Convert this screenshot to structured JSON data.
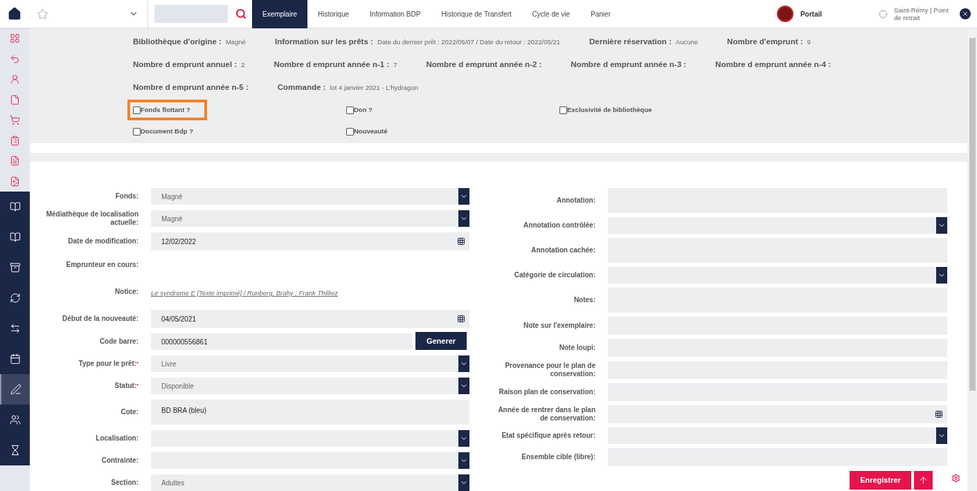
{
  "topbar": {
    "tabs": [
      {
        "label": "Exemplaire",
        "selected": true
      },
      {
        "label": "Historique",
        "selected": false
      },
      {
        "label": "Information BDP",
        "selected": false
      },
      {
        "label": "Historique de Transfert",
        "selected": false
      },
      {
        "label": "Cycle de vie",
        "selected": false
      },
      {
        "label": "Panier",
        "selected": false
      }
    ],
    "portal": "Portail",
    "location": "Saint-Rémy | Point de retrait"
  },
  "sidebar": {
    "items": [
      {
        "kind": "tool",
        "selected": false
      },
      {
        "kind": "tool",
        "selected": false
      },
      {
        "kind": "tool",
        "selected": false
      },
      {
        "kind": "tool",
        "selected": false
      },
      {
        "kind": "tool",
        "selected": false
      },
      {
        "kind": "tool",
        "selected": false
      },
      {
        "kind": "tool",
        "selected": false
      },
      {
        "kind": "tool",
        "selected": false
      },
      {
        "kind": "nav",
        "selected": false
      },
      {
        "kind": "nav",
        "selected": false
      },
      {
        "kind": "nav",
        "selected": false
      },
      {
        "kind": "nav",
        "selected": false
      },
      {
        "kind": "nav",
        "selected": false
      },
      {
        "kind": "nav",
        "selected": false
      },
      {
        "kind": "nav",
        "selected": true
      },
      {
        "kind": "nav",
        "selected": false
      },
      {
        "kind": "nav",
        "selected": false
      }
    ]
  },
  "info": {
    "lines": [
      {
        "fields": [
          {
            "label": "Bibliothèque d'origine :",
            "value": "Magné"
          },
          {
            "label": "Information sur les prêts :",
            "value": "Date du dernier prêt : 2022/05/07 / Date du retour : 2022/05/21"
          },
          {
            "label": "Dernière réservation :",
            "value": "Aucune"
          },
          {
            "label": "Nombre d'emprunt :",
            "value": "9"
          }
        ]
      },
      {
        "fields": [
          {
            "label": "Nombre d emprunt annuel :",
            "value": "2"
          },
          {
            "label": "Nombre d emprunt année n-1 :",
            "value": "7"
          },
          {
            "label": "Nombre d emprunt année n-2 :"
          },
          {
            "label": "Nombre d emprunt année n-3 :"
          },
          {
            "label": "Nombre d emprunt année n-4 :"
          }
        ]
      },
      {
        "fields": [
          {
            "label": "Nombre d emprunt année n-5 :"
          },
          {
            "label": "Commande :",
            "value": "lot 4 janvier 2021 - L'hydragon"
          }
        ]
      }
    ],
    "checkboxes": [
      {
        "label": "Fonds flottant ?",
        "checked": false,
        "highlighted": true
      },
      {
        "label": "Don ?",
        "checked": false,
        "highlighted": false
      },
      {
        "label": "Exclusivité de bibliothèque",
        "checked": false,
        "highlighted": false
      },
      {
        "label": "Document Bdp ?",
        "checked": false,
        "highlighted": false
      },
      {
        "label": "Nouveauté",
        "checked": false,
        "highlighted": false
      }
    ]
  },
  "form": {
    "left": [
      {
        "label": "Fonds:",
        "kind": "select",
        "value": "Magné"
      },
      {
        "label": "Médiathèque de localisation actuelle:",
        "kind": "select",
        "value": "Magné"
      },
      {
        "label": "Date de modification:",
        "kind": "date",
        "value": "12/02/2022"
      },
      {
        "label": "Emprunteur en cours:",
        "kind": "none"
      },
      {
        "label": "Notice:",
        "kind": "link",
        "value": "Le syndrome E [Texte imprimé] / Runberg, Brahy ; Frank Thilliez"
      },
      {
        "label": "Début de la nouveauté:",
        "kind": "date",
        "value": "04/05/2021"
      },
      {
        "label": "Code barre:",
        "kind": "barcode",
        "value": "000000556861",
        "button": "Generer"
      },
      {
        "label": "Type pour le prêt:",
        "required_mark": "*",
        "kind": "select",
        "value": "Livre"
      },
      {
        "label": "Statut:",
        "required_mark": "*",
        "kind": "select",
        "value": "Disponible"
      },
      {
        "label": "Cote:",
        "kind": "textarea",
        "value": "BD BRA (bleu)"
      },
      {
        "label": "Localisation:",
        "kind": "select"
      },
      {
        "label": "Contrainte:",
        "kind": "select"
      },
      {
        "label": "Section:",
        "kind": "select",
        "value": "Adultes"
      }
    ],
    "right": [
      {
        "label": "Annotation:",
        "kind": "textarea"
      },
      {
        "label": "Annotation contrôlée:",
        "kind": "select"
      },
      {
        "label": "Annotation cachée:",
        "kind": "textarea"
      },
      {
        "label": "Catégorie de circulation:",
        "kind": "select"
      },
      {
        "label": "Notes:",
        "kind": "textarea"
      },
      {
        "label": "Note sur l'exemplaire:",
        "kind": "text"
      },
      {
        "label": "Note loupi:",
        "kind": "text"
      },
      {
        "label": "Provenance pour le plan de conservation:",
        "kind": "text"
      },
      {
        "label": "Raison plan de conservation:",
        "kind": "text"
      },
      {
        "label": "Année de rentrer dans le plan de conservation:",
        "kind": "date"
      },
      {
        "label": "Etat spécifique après retour:",
        "kind": "select"
      },
      {
        "label": "Ensemble cible (libre):",
        "kind": "text"
      }
    ]
  },
  "save_button": "Enregistrer"
}
